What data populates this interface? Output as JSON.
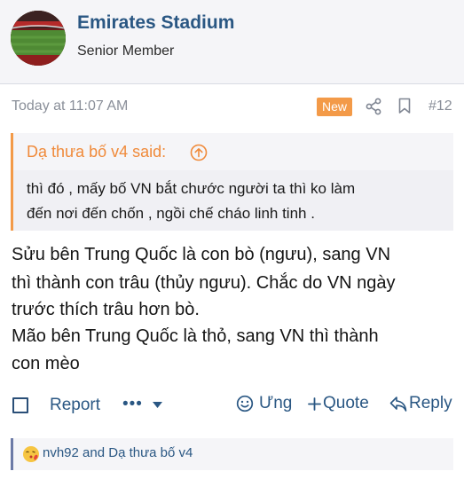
{
  "author": {
    "name": "Emirates Stadium",
    "title": "Senior Member",
    "avatar_icon": "stadium-avatar"
  },
  "post": {
    "time": "Today at 11:07 AM",
    "badge": "New",
    "number": "#12"
  },
  "quote": {
    "author_label": "Dạ thưa bố v4 said:",
    "lines": [
      "thì đó , mấy bố VN bắt chước người ta thì ko làm",
      "đến nơi đến chốn , ngồi chế cháo linh tinh ."
    ]
  },
  "body": {
    "lines": [
      "Sửu bên Trung Quốc là con bò (ngưu), sang VN",
      "thì thành con trâu (thủy ngưu). Chắc do VN ngày",
      "trước thích trâu hơn bò.",
      "Mão bên Trung Quốc là thỏ, sang VN thì thành",
      "con mèo"
    ]
  },
  "actions": {
    "report": "Report",
    "more": "•••",
    "react": "Ưng",
    "quote": "Quote",
    "reply": "Reply"
  },
  "reactions": {
    "text": "nvh92 and Dạ thưa bố v4",
    "icon": "kiss-emoji-icon"
  },
  "colors": {
    "link": "#2a5783",
    "accent": "#f39a48",
    "muted": "#8a8f99",
    "panel": "#f5f5f8"
  }
}
